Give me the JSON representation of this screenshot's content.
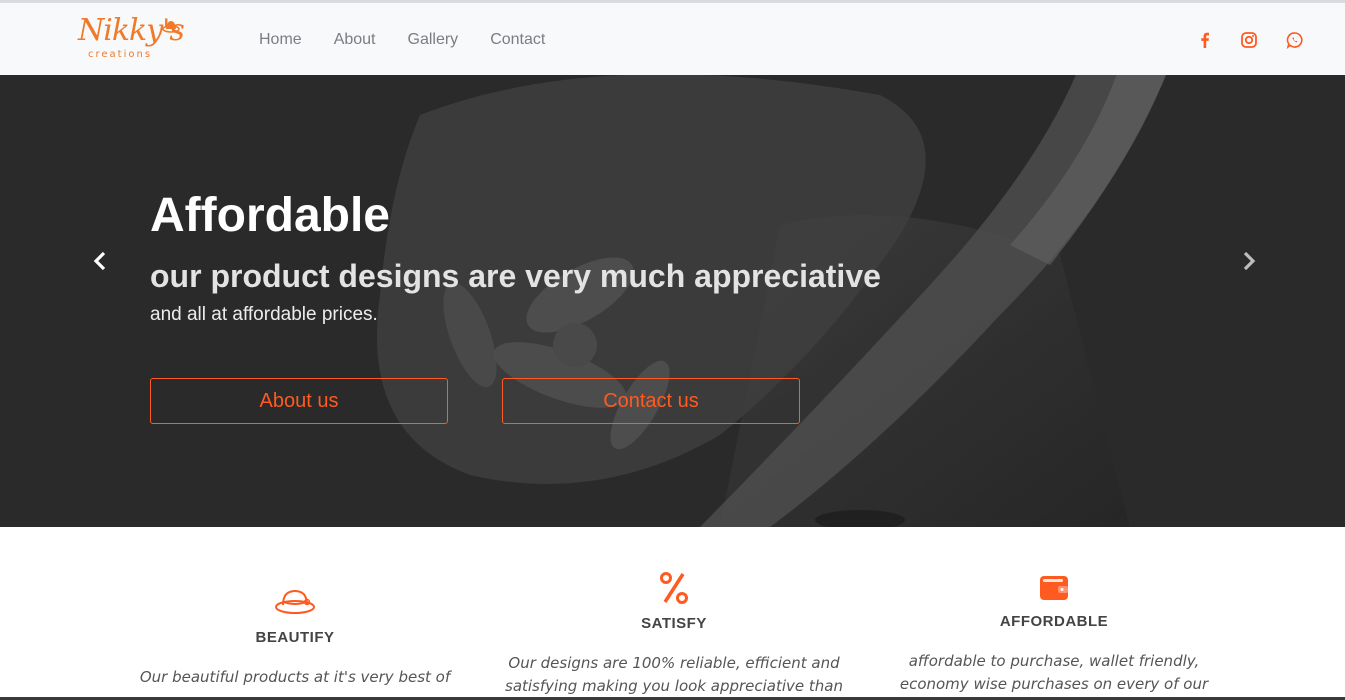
{
  "brand": {
    "logo_text": "Nikky's",
    "logo_sub": "creations"
  },
  "nav": {
    "links": [
      "Home",
      "About",
      "Gallery",
      "Contact"
    ]
  },
  "social": {
    "icons": [
      "facebook-icon",
      "instagram-icon",
      "whatsapp-icon"
    ]
  },
  "hero": {
    "title": "Affordable",
    "subtitle": "our product designs are very much appreciative",
    "caption": "and all at affordable prices.",
    "button_about": "About us",
    "button_contact": "Contact us"
  },
  "features": [
    {
      "icon": "hat-icon",
      "title": "BEAUTIFY",
      "text": "Our beautiful products at it's very best of"
    },
    {
      "icon": "percent-icon",
      "title": "SATISFY",
      "text": "Our designs are 100% reliable, efficient and satisfying making you look appreciative than"
    },
    {
      "icon": "wallet-icon",
      "title": "AFFORDABLE",
      "text": "affordable to purchase, wallet friendly, economy wise purchases on every of our"
    }
  ],
  "colors": {
    "accent": "#ff5a1f",
    "logo": "#f07a2a",
    "hero_bg": "#353535",
    "navbar_bg": "#f8f9fb",
    "nav_text": "#7a7d82"
  }
}
